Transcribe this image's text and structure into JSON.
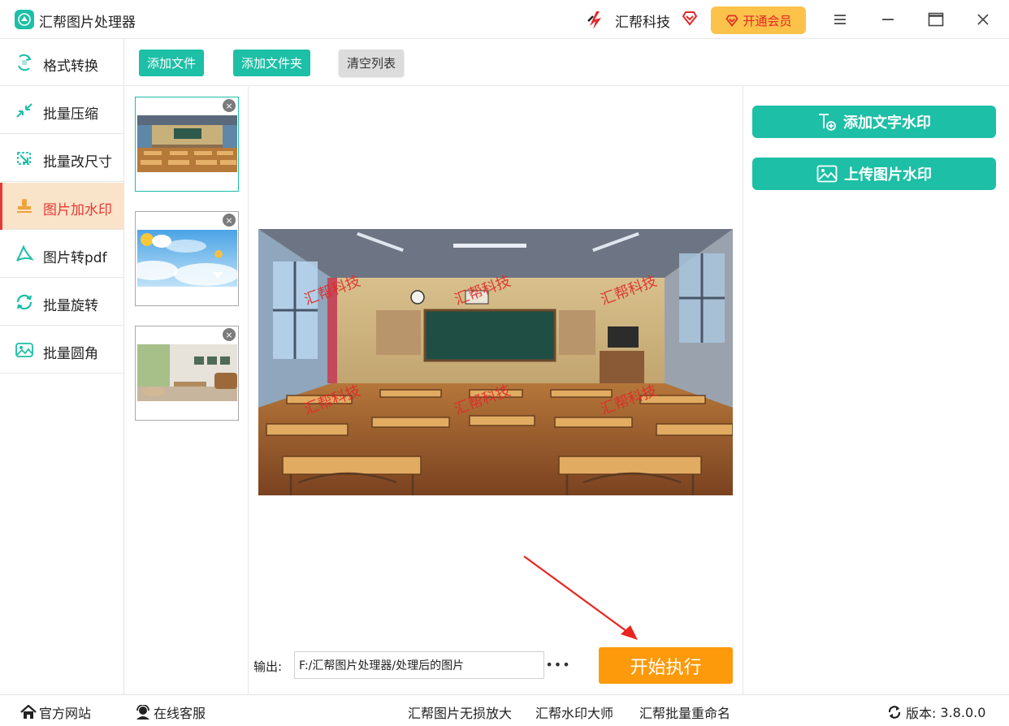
{
  "app": {
    "title": "汇帮图片处理器",
    "brand_name": "汇帮科技",
    "vip_label": "开通会员"
  },
  "sidebar": {
    "items": [
      {
        "label": "格式转换",
        "icon": "format-convert-icon"
      },
      {
        "label": "批量压缩",
        "icon": "compress-icon"
      },
      {
        "label": "批量改尺寸",
        "icon": "resize-icon"
      },
      {
        "label": "图片加水印",
        "icon": "stamp-icon",
        "active": true
      },
      {
        "label": "图片转pdf",
        "icon": "pdf-icon"
      },
      {
        "label": "批量旋转",
        "icon": "rotate-icon"
      },
      {
        "label": "批量圆角",
        "icon": "rounded-corner-icon"
      }
    ]
  },
  "toolbar": {
    "add_file": "添加文件",
    "add_folder": "添加文件夹",
    "clear_list": "清空列表"
  },
  "thumbnails": [
    {
      "subject": "classroom",
      "selected": true
    },
    {
      "subject": "sky-clouds"
    },
    {
      "subject": "living-room"
    }
  ],
  "preview": {
    "watermark_text": "汇帮科技"
  },
  "output": {
    "label": "输出:",
    "path": "F:/汇帮图片处理器/处理后的图片",
    "more": "•••",
    "start_label": "开始执行"
  },
  "right_panel": {
    "add_text_watermark": "添加文字水印",
    "upload_image_watermark": "上传图片水印"
  },
  "footer": {
    "website": "官方网站",
    "support": "在线客服",
    "link1": "汇帮图片无损放大",
    "link2": "汇帮水印大师",
    "link3": "汇帮批量重命名",
    "version_label": "版本:",
    "version": "3.8.0.0"
  },
  "colors": {
    "accent": "#1dbfa6",
    "active_bg": "#f9e3c9",
    "active_text": "#e53935",
    "vip_bg": "#fcc24a",
    "start_bg": "#fd9a0c"
  }
}
